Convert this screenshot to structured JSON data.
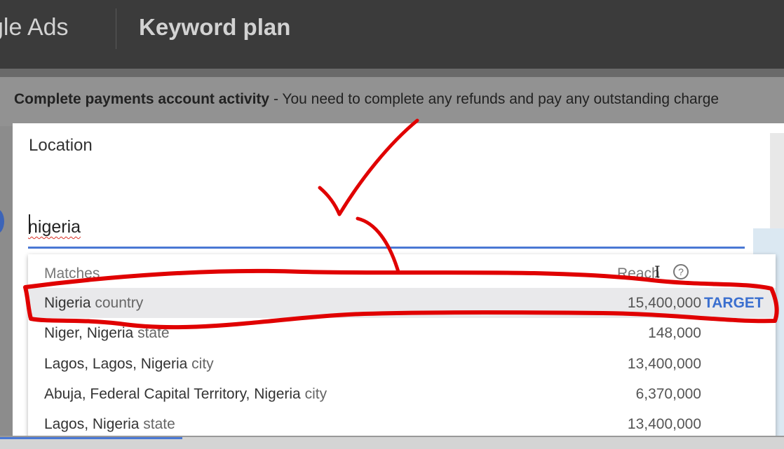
{
  "app": {
    "brand": "gle Ads",
    "page_title": "Keyword plan"
  },
  "banner": {
    "bold": "Complete payments account activity",
    "separator": " - ",
    "message": "You need to complete any refunds and pay any outstanding charge"
  },
  "dialog": {
    "title": "Location",
    "search_value": "nigeria"
  },
  "dropdown": {
    "header_matches": "Matches",
    "header_reach": "Reach",
    "help_glyph": "?",
    "target_label": "TARGET",
    "rows": [
      {
        "name": "Nigeria",
        "type": "country",
        "reach": "15,400,000",
        "selected": true
      },
      {
        "name": "Niger, Nigeria",
        "type": "state",
        "reach": "148,000"
      },
      {
        "name": "Lagos, Lagos, Nigeria",
        "type": "city",
        "reach": "13,400,000"
      },
      {
        "name": "Abuja, Federal Capital Territory, Nigeria",
        "type": "city",
        "reach": "6,370,000"
      },
      {
        "name": "Lagos, Nigeria",
        "type": "state",
        "reach": "13,400,000"
      }
    ]
  },
  "icons": [
    "help-icon",
    "text-cursor-icon"
  ],
  "colors": {
    "accent": "#3b6fcf",
    "annotation": "#e00000",
    "topbar": "#3b3b3b"
  }
}
